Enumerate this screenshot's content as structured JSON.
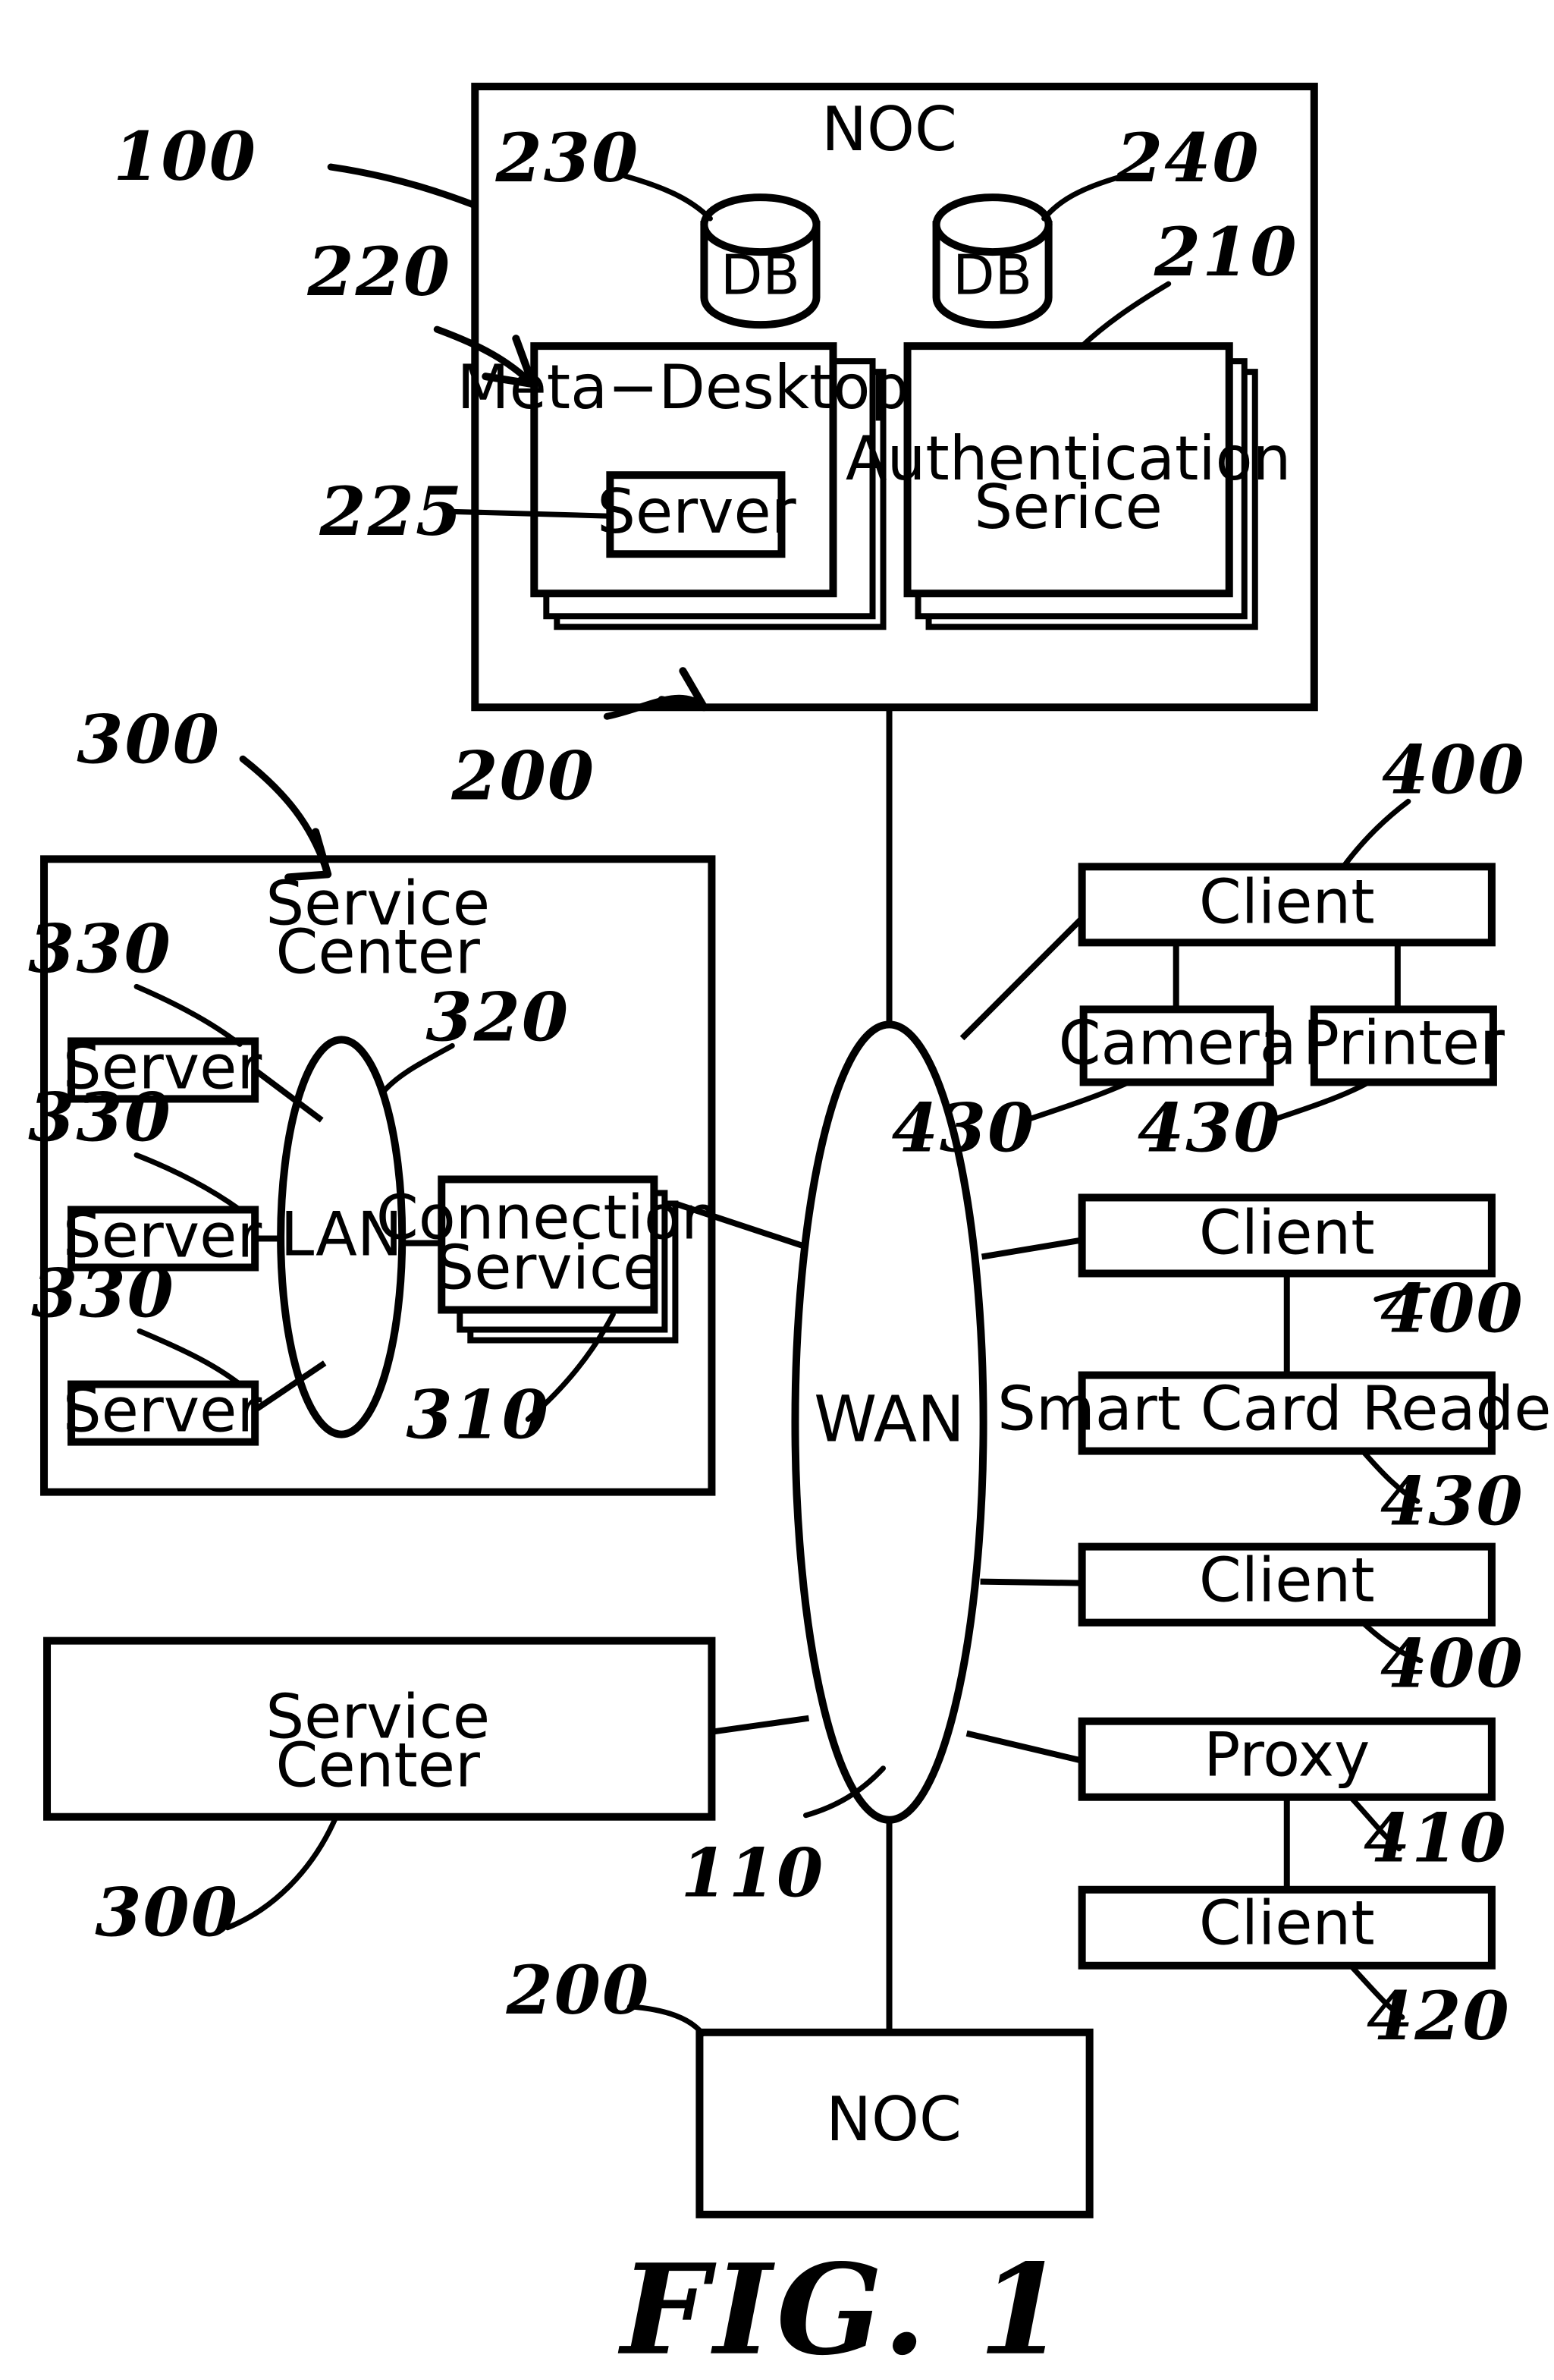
{
  "figure": {
    "title": "FIG.  1",
    "system_ref": "100"
  },
  "noc_top": {
    "title": "NOC",
    "ref": "200",
    "databases": [
      {
        "label": "DB",
        "ref": "230"
      },
      {
        "label": "DB",
        "ref": "240"
      }
    ],
    "meta_desktop": {
      "label": "Meta−Desktop",
      "ref": "220",
      "server": {
        "label": "Server",
        "ref": "225"
      }
    },
    "auth_service": {
      "label_line1": "Authentication",
      "label_line2": "Serice",
      "ref": "210"
    }
  },
  "service_center_top": {
    "title_line1": "Service",
    "title_line2": "Center",
    "ref": "300",
    "lan": {
      "label": "LAN",
      "ref": "320"
    },
    "servers": [
      {
        "label": "Server",
        "ref": "330"
      },
      {
        "label": "Server",
        "ref": "330"
      },
      {
        "label": "Server",
        "ref": "330"
      }
    ],
    "connection_service": {
      "label_line1": "Connection",
      "label_line2": "Service",
      "ref": "310"
    }
  },
  "service_center_bottom": {
    "title_line1": "Service",
    "title_line2": "Center",
    "ref": "300"
  },
  "wan": {
    "label": "WAN",
    "ref": "110"
  },
  "noc_bottom": {
    "label": "NOC",
    "ref": "200"
  },
  "clients": [
    {
      "label": "Client",
      "ref": "400",
      "peripherals": [
        {
          "label": "Camera",
          "ref": "430"
        },
        {
          "label": "Printer",
          "ref": "430"
        }
      ]
    },
    {
      "label": "Client",
      "ref": "400",
      "peripherals": [
        {
          "label": "Smart Card Reader",
          "ref": "430"
        }
      ]
    },
    {
      "label": "Client",
      "ref": "400",
      "peripherals": []
    }
  ],
  "proxy_branch": {
    "proxy": {
      "label": "Proxy",
      "ref": "410"
    },
    "client": {
      "label": "Client",
      "ref": "420"
    }
  },
  "colors": {
    "ink": "#000000",
    "paper": "#ffffff"
  }
}
